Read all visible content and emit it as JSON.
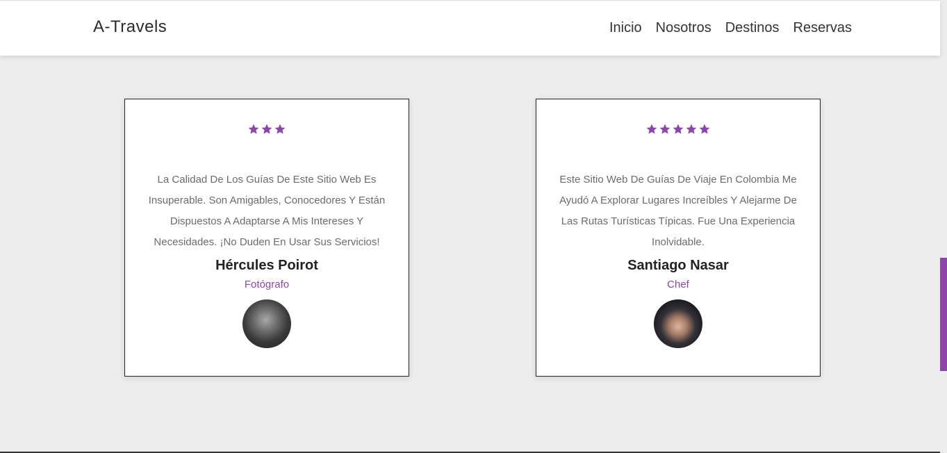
{
  "header": {
    "logo": "A-Travels",
    "nav": [
      "Inicio",
      "Nosotros",
      "Destinos",
      "Reservas"
    ]
  },
  "testimonials": [
    {
      "stars": 3,
      "quote": "La Calidad De Los Guías De Este Sitio Web Es Insuperable. Son Amigables, Conocedores Y Están Dispuestos A Adaptarse A Mis Intereses Y Necesidades. ¡No Duden En Usar Sus Servicios!",
      "name": "Hércules Poirot",
      "role": "Fotógrafo",
      "avatar": "avatar-grayscale-man"
    },
    {
      "stars": 5,
      "quote": "Este Sitio Web De Guías De Viaje En Colombia Me Ayudó A Explorar Lugares Increíbles Y Alejarme De Las Rutas Turísticas Típicas. Fue Una Experiencia Inolvidable.",
      "name": "Santiago Nasar",
      "role": "Chef",
      "avatar": "avatar-young-man"
    }
  ],
  "colors": {
    "accent": "#8e44ad",
    "background": "#ececec",
    "header_bg": "#ffffff"
  },
  "icons": {
    "star": "star-icon"
  }
}
